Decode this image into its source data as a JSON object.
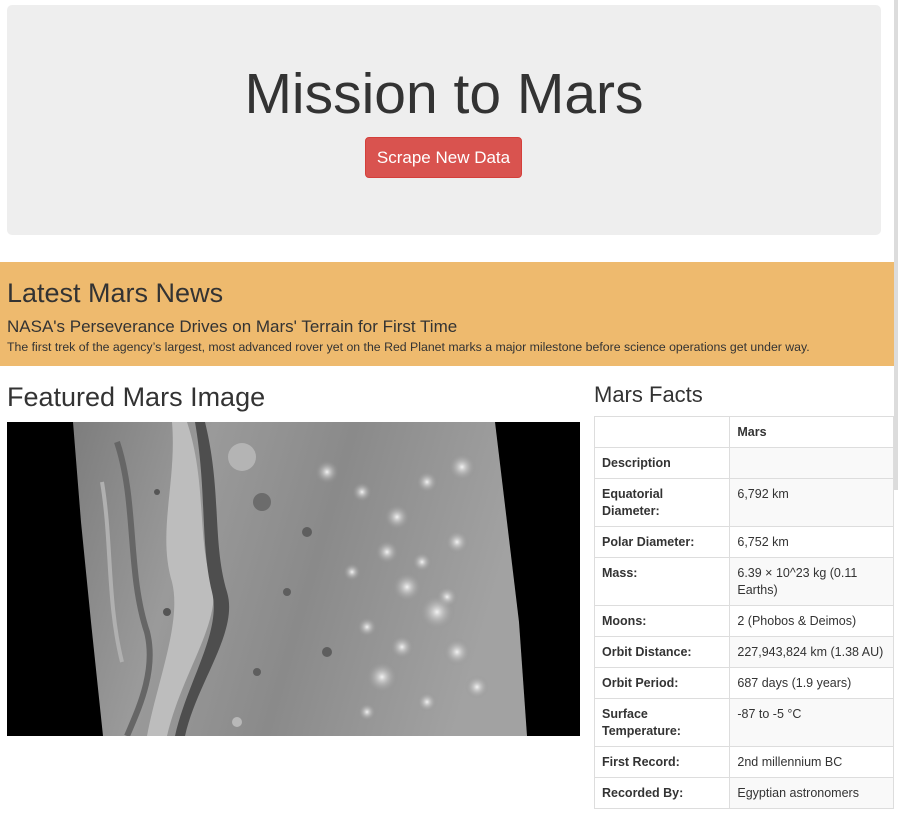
{
  "header": {
    "title": "Mission to Mars",
    "scrape_button": "Scrape New Data",
    "colors": {
      "background": "#eeeeee",
      "button": "#d9534f"
    }
  },
  "news": {
    "heading": "Latest Mars News",
    "title": "NASA's Perseverance Drives on Mars' Terrain for First Time",
    "teaser": "The first trek of the agency’s largest, most advanced rover yet on the Red Planet marks a major milestone before science operations get under way.",
    "background": "#eeba6e"
  },
  "featured": {
    "heading": "Featured Mars Image"
  },
  "facts": {
    "heading": "Mars Facts",
    "column_header": "Mars",
    "rows": [
      {
        "label": "Description",
        "value": ""
      },
      {
        "label": "Equatorial Diameter:",
        "value": "6,792 km"
      },
      {
        "label": "Polar Diameter:",
        "value": "6,752 km"
      },
      {
        "label": "Mass:",
        "value": "6.39 × 10^23 kg (0.11 Earths)"
      },
      {
        "label": "Moons:",
        "value": "2 (Phobos & Deimos)"
      },
      {
        "label": "Orbit Distance:",
        "value": "227,943,824 km (1.38 AU)"
      },
      {
        "label": "Orbit Period:",
        "value": "687 days (1.9 years)"
      },
      {
        "label": "Surface Temperature:",
        "value": "-87 to -5 °C"
      },
      {
        "label": "First Record:",
        "value": "2nd millennium BC"
      },
      {
        "label": "Recorded By:",
        "value": "Egyptian astronomers"
      }
    ]
  }
}
